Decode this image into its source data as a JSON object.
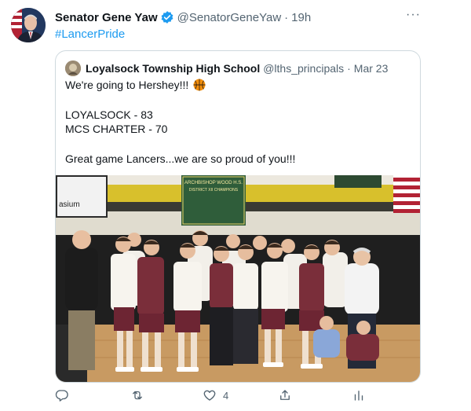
{
  "tweet": {
    "author_name": "Senator Gene Yaw",
    "author_handle": "@SenatorGeneYaw",
    "separator": "·",
    "time": "19h",
    "text": "#LancerPride",
    "more_label": "···"
  },
  "quoted": {
    "author_name": "Loyalsock Township High School",
    "author_handle": "@lths_principals",
    "separator": "·",
    "date": "Mar 23",
    "line1": "We're going to Hershey!!!",
    "line2": "LOYALSOCK - 83",
    "line3": "MCS CHARTER - 70",
    "line4": "Great game Lancers...we are so proud of you!!!"
  },
  "photo": {
    "banner_lines": [
      "ARCHBISHOP WOOD H.S.",
      "DISTRICT XII CHAMPIONS"
    ],
    "wall_text": "asium"
  },
  "actions": {
    "reply_count": "",
    "retweet_count": "",
    "like_count": "4",
    "share_count": ""
  },
  "colors": {
    "accent": "#1d9bf0",
    "secondary_text": "#536471",
    "border": "#cfd9de"
  }
}
